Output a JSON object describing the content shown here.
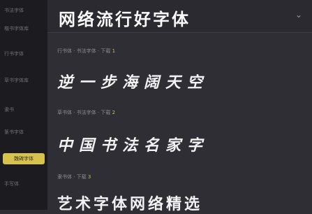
{
  "sidebar": {
    "items": [
      {
        "label": "书法字体"
      },
      {
        "label": "楷书字体库"
      },
      {
        "label": "行书字体"
      },
      {
        "label": "草书字体库"
      },
      {
        "label": "隶书"
      },
      {
        "label": "篆书字体"
      },
      {
        "label": "魏碑字体"
      },
      {
        "label": "手写体"
      }
    ]
  },
  "header": {
    "title": "网络流行好字体"
  },
  "sections": [
    {
      "label": "行书体 · 书法字体 · 下载",
      "label_highlight": "1",
      "sample": "逆一步海阔天空"
    },
    {
      "label": "草书体 · 书法字体 · 下载",
      "label_highlight": "2",
      "sample": "中国书法名家字"
    },
    {
      "label": "隶书体 · 下载",
      "label_highlight": "3",
      "sample": "艺术字体网络精选"
    }
  ]
}
